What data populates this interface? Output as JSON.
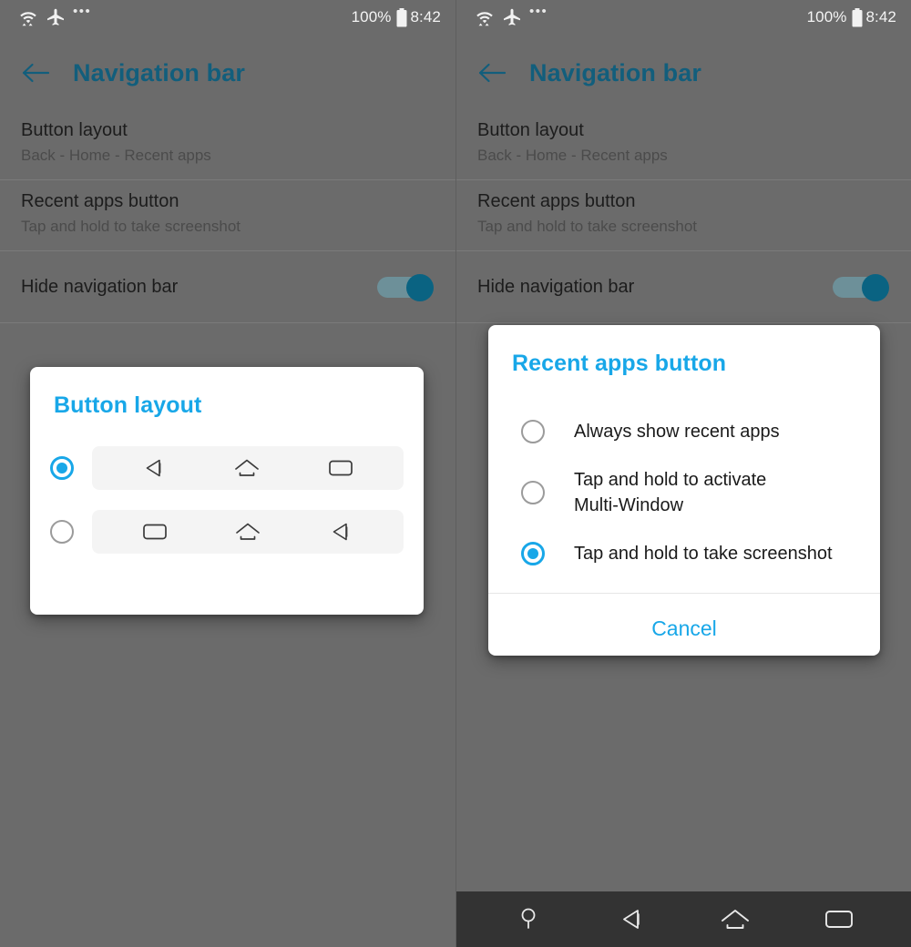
{
  "status_bar": {
    "wifi_icon": "wifi-icon",
    "airplane_icon": "airplane-mode-icon",
    "overflow_icon": "more-dots-icon",
    "battery_percent": "100%",
    "battery_icon": "battery-full-icon",
    "time": "8:42"
  },
  "app_bar": {
    "back_icon": "back-arrow-icon",
    "title": "Navigation bar"
  },
  "settings": [
    {
      "title": "Button layout",
      "subtitle": "Back - Home - Recent apps"
    },
    {
      "title": "Recent apps button",
      "subtitle": "Tap and hold to take screenshot"
    },
    {
      "title": "Hide navigation bar",
      "toggle_on": true
    }
  ],
  "button_layout_dialog": {
    "title": "Button layout",
    "options": [
      {
        "selected": true,
        "icons": [
          "back-icon",
          "home-icon",
          "recents-icon"
        ]
      },
      {
        "selected": false,
        "icons": [
          "recents-icon",
          "home-icon",
          "back-icon"
        ]
      }
    ]
  },
  "recent_apps_dialog": {
    "title": "Recent apps button",
    "options": [
      {
        "label": "Always show recent apps",
        "selected": false
      },
      {
        "label": "Tap and hold to activate\nMulti-Window",
        "selected": false
      },
      {
        "label": "Tap and hold to take screenshot",
        "selected": true
      }
    ],
    "cancel_label": "Cancel"
  },
  "system_nav_bar": {
    "buttons": [
      "keyboard-hide-icon",
      "back-icon",
      "home-icon",
      "recents-icon"
    ]
  },
  "colors": {
    "background": "#6b6b6b",
    "accent_blue": "#18a7e8",
    "title_teal": "#125e7c",
    "toggle_on": "#0a6382",
    "navbar_dark": "#333333"
  }
}
